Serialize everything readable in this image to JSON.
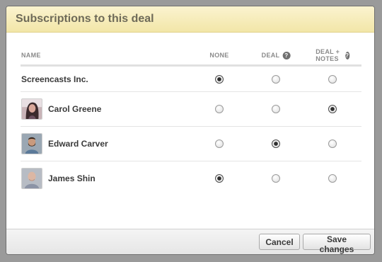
{
  "dialog": {
    "title": "Subscriptions to this deal"
  },
  "table": {
    "columns": {
      "name": "NAME",
      "none": "NONE",
      "deal": "DEAL",
      "deal_notes": "DEAL + NOTES"
    },
    "rows": [
      {
        "name": "Screencasts Inc.",
        "avatar": null,
        "selected": "none"
      },
      {
        "name": "Carol Greene",
        "avatar": "woman-portrait",
        "selected": "deal_notes"
      },
      {
        "name": "Edward Carver",
        "avatar": "bearded-man-portrait",
        "selected": "deal"
      },
      {
        "name": "James Shin",
        "avatar": "bald-man-portrait",
        "selected": "none"
      }
    ]
  },
  "footer": {
    "cancel_label": "Cancel",
    "save_label": "Save changes"
  },
  "icons": {
    "help": "?"
  },
  "colors": {
    "header_bg": "#f2e6a8",
    "header_text": "#6e6a58",
    "overlay": "#9a9a9a"
  }
}
